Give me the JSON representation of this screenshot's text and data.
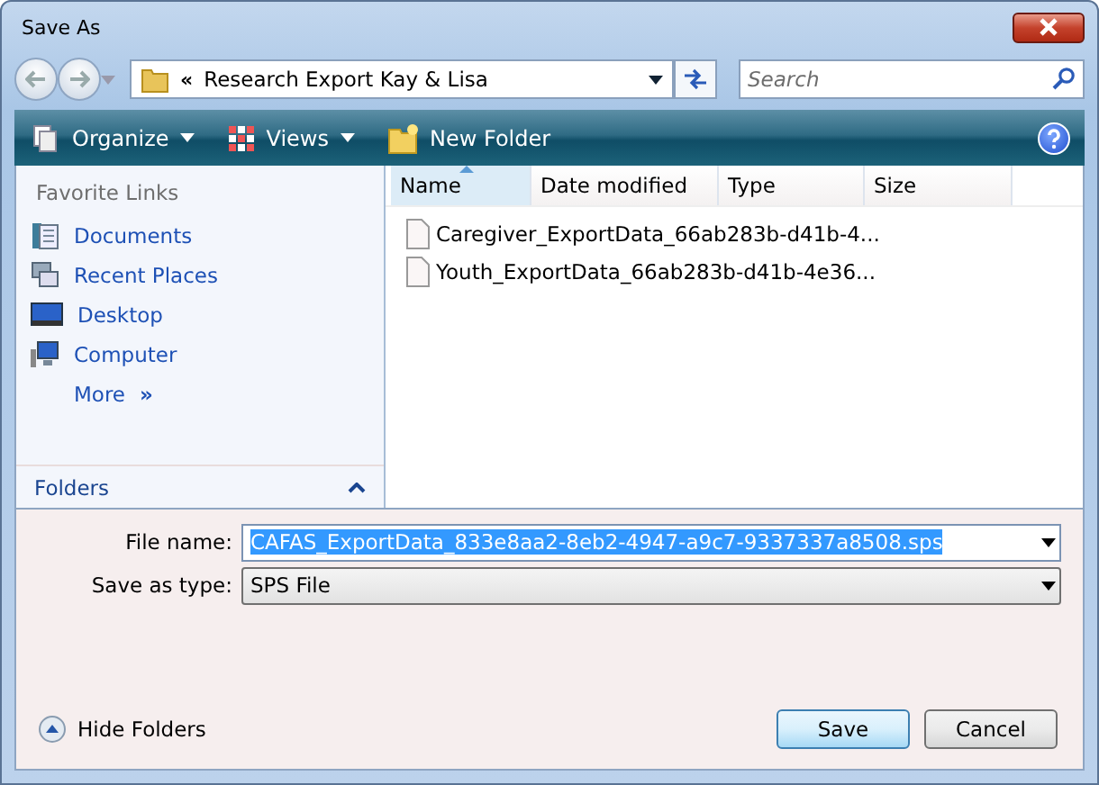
{
  "window": {
    "title": "Save As"
  },
  "address_bar": {
    "chevron": "«",
    "path": "Research Export Kay & Lisa"
  },
  "search": {
    "placeholder": "Search"
  },
  "toolbar": [
    {
      "label": "Organize",
      "kind": "organize"
    },
    {
      "label": "Views",
      "kind": "views"
    },
    {
      "label": "New Folder",
      "kind": "new-folder"
    }
  ],
  "favorite_links": {
    "title": "Favorite Links",
    "items": [
      {
        "label": "Documents",
        "kind": "documents"
      },
      {
        "label": "Recent Places",
        "kind": "recent"
      },
      {
        "label": "Desktop",
        "kind": "desktop"
      },
      {
        "label": "Computer",
        "kind": "computer"
      },
      {
        "label": "More",
        "kind": "more",
        "chevron": "»"
      }
    ]
  },
  "folders": {
    "label": "Folders"
  },
  "file_list": {
    "columns": [
      {
        "label": "Name",
        "selected": true
      },
      {
        "label": "Date modified",
        "selected": false
      },
      {
        "label": "Type",
        "selected": false
      },
      {
        "label": "Size",
        "selected": false
      }
    ],
    "files": [
      {
        "name": "Caregiver_ExportData_66ab283b-d41b-4..."
      },
      {
        "name": "Youth_ExportData_66ab283b-d41b-4e36..."
      }
    ]
  },
  "file_name": {
    "label": "File name:",
    "value": "CAFAS_ExportData_833e8aa2-8eb2-4947-a9c7-9337337a8508.sps",
    "selected": true
  },
  "save_as_type": {
    "label": "Save as type:",
    "value": "SPS File"
  },
  "hide_folders": {
    "label": "Hide Folders"
  },
  "buttons": [
    {
      "label": "Save",
      "kind": "default"
    },
    {
      "label": "Cancel",
      "kind": "normal"
    }
  ]
}
